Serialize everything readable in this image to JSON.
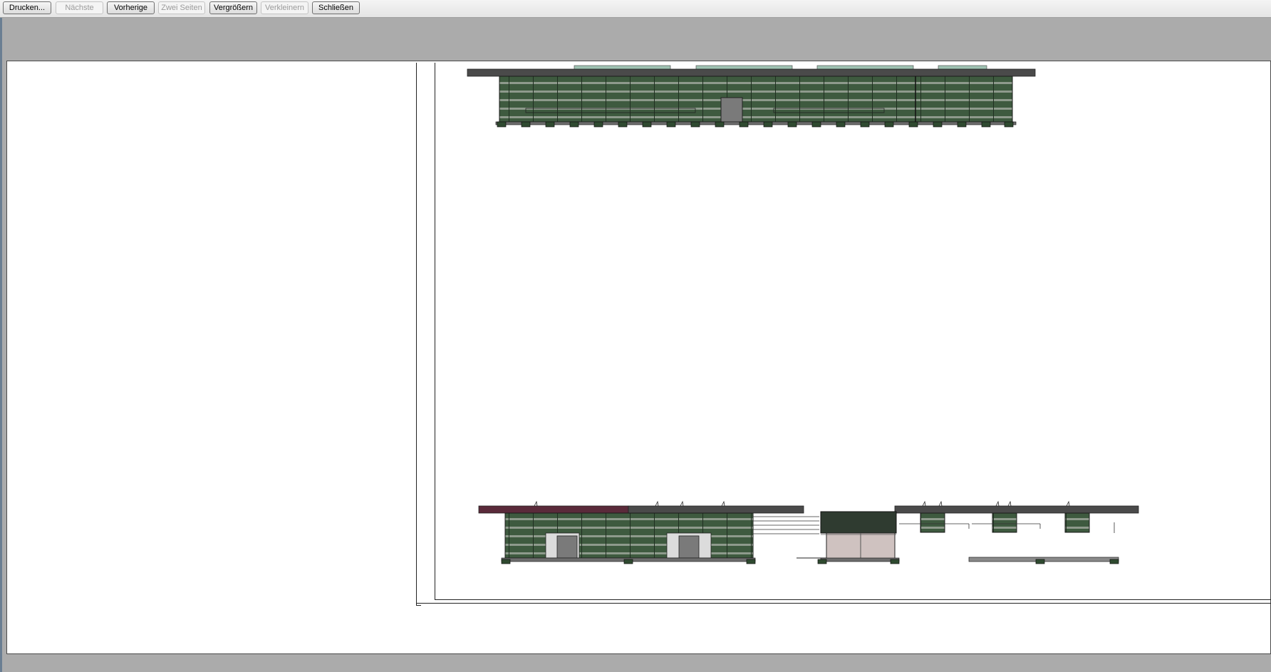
{
  "toolbar": {
    "print_label": "Drucken...",
    "next_label": "Nächste",
    "previous_label": "Vorherige",
    "two_pages_label": "Zwei Seiten",
    "zoom_in_label": "Vergrößern",
    "zoom_out_label": "Verkleinern",
    "close_label": "Schließen"
  },
  "colors": {
    "toolbar_bg": "#ececec",
    "workspace_bg": "#ababab",
    "page_bg": "#ffffff",
    "facade_green": "#3e5a3f",
    "facade_stripe": "#8e9a8c",
    "roof_dark": "#4a4a4a",
    "skylight": "#9fc2b2",
    "wood_panel": "#cfc2c0"
  }
}
